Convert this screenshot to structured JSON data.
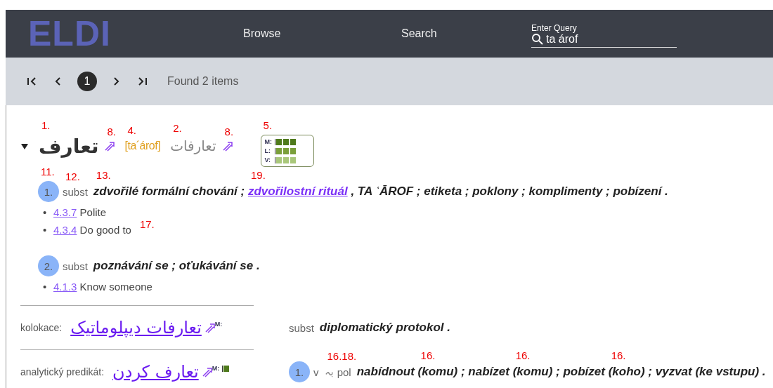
{
  "header": {
    "logo": "ELDI",
    "nav": [
      {
        "label": "Browse"
      },
      {
        "label": "Search"
      }
    ],
    "query": {
      "label": "Enter Query",
      "value": "ta árof"
    }
  },
  "pager": {
    "buttons": [
      {
        "kind": "first"
      },
      {
        "kind": "prev"
      },
      {
        "kind": "page",
        "label": "1",
        "selected": true
      },
      {
        "kind": "next"
      },
      {
        "kind": "last"
      }
    ],
    "status": "Found 2 items"
  },
  "entry": {
    "expanded": true,
    "headword": {
      "text": "تعارف",
      "note": "1."
    },
    "headword_link": {
      "note": "8."
    },
    "pronunciation": {
      "text": "[ta´árof]",
      "note": "4."
    },
    "plural": {
      "text": "تعارفات",
      "note": "2."
    },
    "plural_link": {
      "note": "8."
    },
    "frequency": {
      "note": "5.",
      "rows": [
        {
          "label": "M:",
          "level": 1,
          "color": "#4f7a1c"
        },
        {
          "label": "L:",
          "level": 1,
          "color": "#7a9f3a"
        },
        {
          "label": "V:",
          "level": 1,
          "color": "#a9c77a"
        }
      ]
    },
    "senses": [
      {
        "number": "1.",
        "number_note": "11.",
        "pos": "subst",
        "pos_note": "12.",
        "definition": [
          {
            "kind": "text",
            "text": "zdvořilé formální chování ; ",
            "note": "13."
          },
          {
            "kind": "link",
            "text": "zdvořilostní rituál",
            "note": "19."
          },
          {
            "kind": "text",
            "text": " , TA ʿĀROF ; etiketa ; poklony ; komplimenty ; pobízení ."
          }
        ],
        "domains": [
          {
            "bullet": "•",
            "code": "4.3.7",
            "label": "Polite"
          },
          {
            "bullet": "•",
            "code": "4.3.4",
            "label": "Do good to",
            "note": "17."
          }
        ]
      },
      {
        "number": "2.",
        "pos": "subst",
        "definition": [
          {
            "kind": "text",
            "text": "poznávání se ; oťukávání se ."
          }
        ],
        "domains": [
          {
            "bullet": "•",
            "code": "4.1.3",
            "label": "Know someone"
          }
        ]
      }
    ],
    "phrases": [
      {
        "type": "kolokace:",
        "text": "تعارفات دیپلوماتیک",
        "frequency": [
          {
            "label": "M:"
          }
        ],
        "senses": [
          {
            "pos": "subst",
            "definition": [
              {
                "kind": "text",
                "text": "diplomatický protokol ."
              }
            ]
          }
        ]
      },
      {
        "type": "analytický predikát:",
        "text": "تعارف کردن",
        "frequency": [
          {
            "label": "M:",
            "level": 0.34,
            "color": "#4f7a1c"
          }
        ],
        "senses": [
          {
            "number": "1.",
            "pos": "v",
            "particle": "بہ",
            "particle_note": "16.18.",
            "register": "pol",
            "definition": [
              {
                "kind": "text",
                "text": "nabídnout "
              },
              {
                "kind": "text",
                "text": "(komu)",
                "note": "16."
              },
              {
                "kind": "text",
                "text": " ; nabízet "
              },
              {
                "kind": "text",
                "text": "(komu)",
                "note": "16."
              },
              {
                "kind": "text",
                "text": " ; pobízet "
              },
              {
                "kind": "text",
                "text": "(koho)",
                "note": "16."
              },
              {
                "kind": "text",
                "text": " ; vyzvat (ke vstupu) ."
              }
            ]
          }
        ]
      }
    ]
  }
}
